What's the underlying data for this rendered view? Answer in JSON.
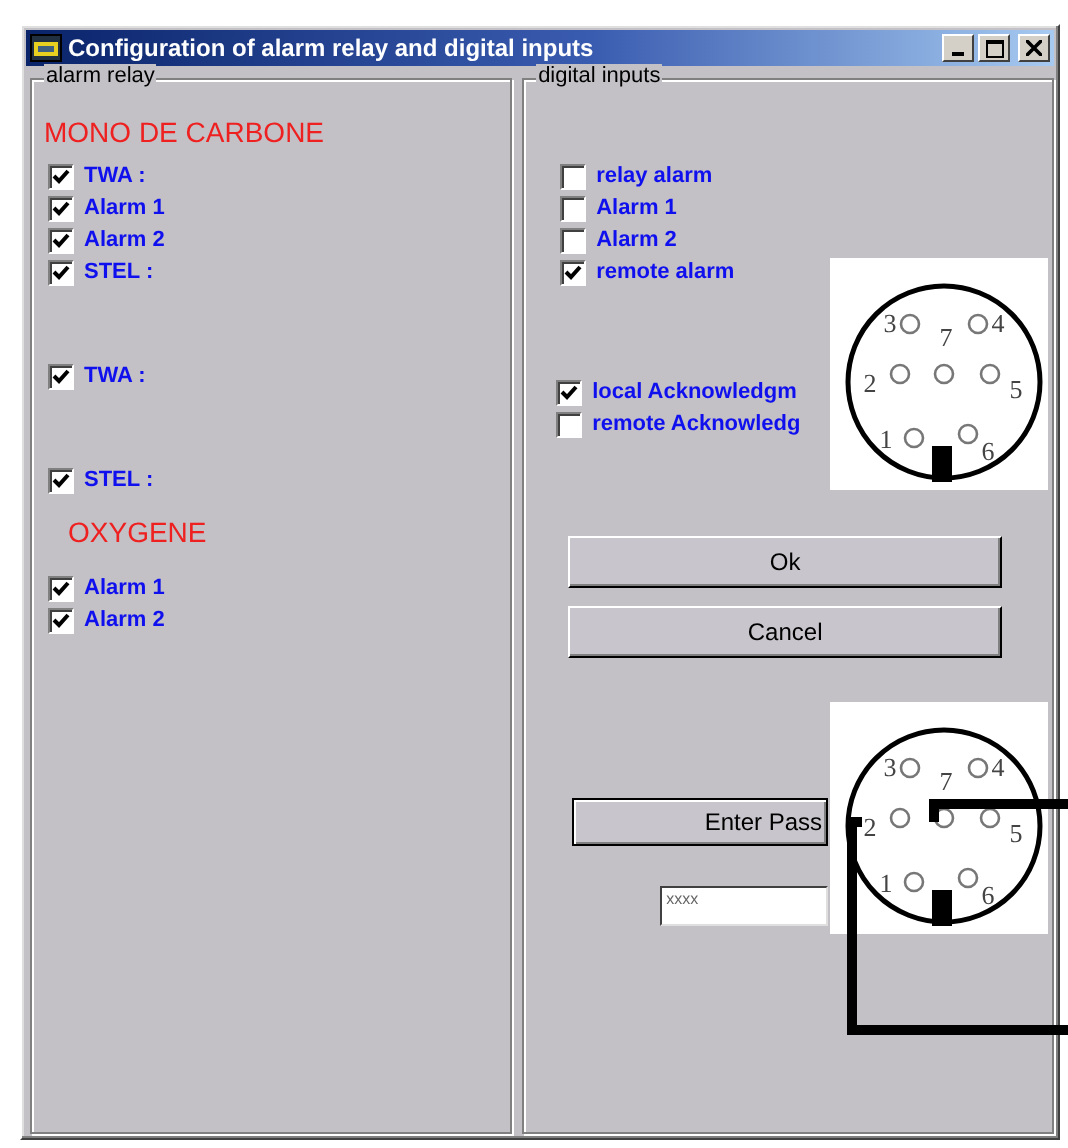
{
  "window": {
    "title": "Configuration of alarm relay and digital inputs"
  },
  "alarm_relay": {
    "label": "alarm relay",
    "groups": [
      {
        "heading": "MONO DE CARBONE",
        "items": [
          {
            "label": "TWA :",
            "checked": true
          },
          {
            "label": "Alarm 1",
            "checked": true
          },
          {
            "label": "Alarm 2",
            "checked": true
          },
          {
            "label": "STEL :",
            "checked": true
          }
        ]
      },
      {
        "items": [
          {
            "label": "TWA :",
            "checked": true
          }
        ]
      },
      {
        "items": [
          {
            "label": "STEL :",
            "checked": true
          }
        ]
      },
      {
        "heading": "OXYGENE",
        "items": [
          {
            "label": "Alarm 1",
            "checked": true
          },
          {
            "label": "Alarm 2",
            "checked": true
          }
        ]
      }
    ]
  },
  "digital_inputs": {
    "label": "digital inputs",
    "inputs": [
      {
        "label": "relay alarm",
        "checked": false
      },
      {
        "label": "Alarm 1",
        "checked": false
      },
      {
        "label": "Alarm 2",
        "checked": false
      },
      {
        "label": "remote alarm",
        "checked": true
      }
    ],
    "acknowledgement": [
      {
        "label": "local Acknowledgm",
        "checked": true
      },
      {
        "label": "remote Acknowledg",
        "checked": false
      }
    ],
    "buttons": [
      "Ok",
      "Cancel"
    ],
    "password_button": "Enter Pass",
    "password_field": {
      "value": "xxxx"
    }
  },
  "connector_diagrams": [
    {
      "kind": "plain",
      "pins": [
        "3",
        "7",
        "4",
        "2",
        "5",
        "1",
        "6"
      ]
    },
    {
      "kind": "wired",
      "pins": [
        "3",
        "7",
        "4",
        "2",
        "5",
        "1",
        "6"
      ]
    }
  ]
}
